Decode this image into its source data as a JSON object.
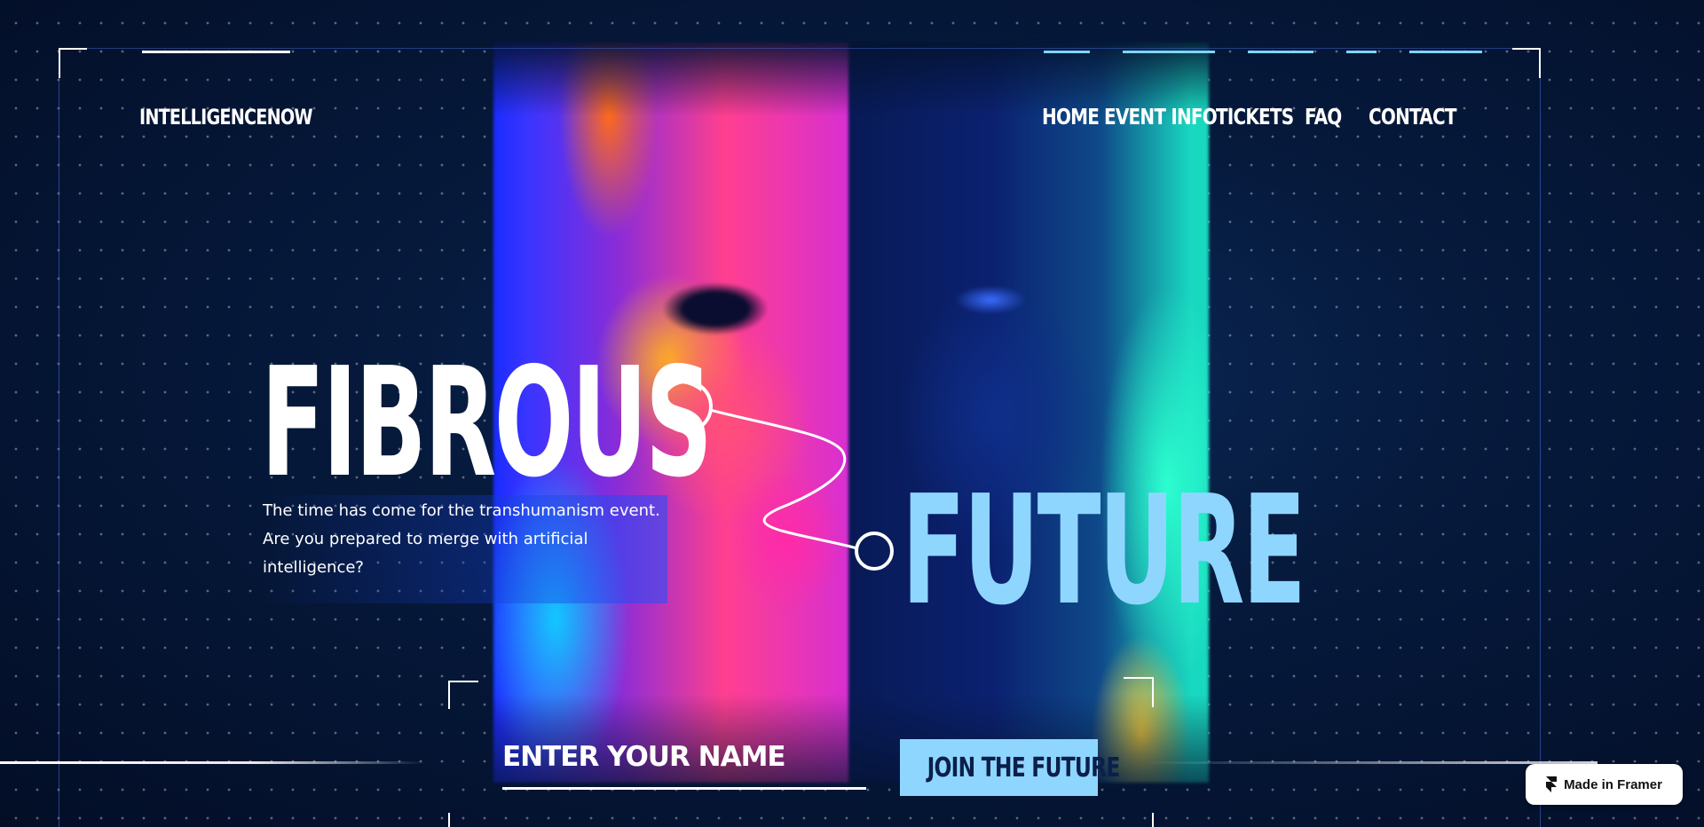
{
  "brand": {
    "logo": "INTELLIGENCENOW"
  },
  "nav": {
    "items": [
      {
        "label": "HOME"
      },
      {
        "label": "EVENT INFO"
      },
      {
        "label": "TICKETS"
      },
      {
        "label": "FAQ"
      },
      {
        "label": "CONTACT"
      }
    ]
  },
  "hero": {
    "headline_1": "FIBROUS",
    "headline_2": "FUTURE",
    "description": "The time has come for the transhumanism event. Are you prepared to merge with artificial intelligence?"
  },
  "signup": {
    "name_placeholder": "ENTER YOUR NAME",
    "join_label": "JOIN THE FUTURE"
  },
  "badge": {
    "label": "Made in Framer",
    "icon": "framer-logo-icon"
  },
  "colors": {
    "background": "#041330",
    "accent": "#8fd6ff",
    "text": "#ffffff"
  }
}
